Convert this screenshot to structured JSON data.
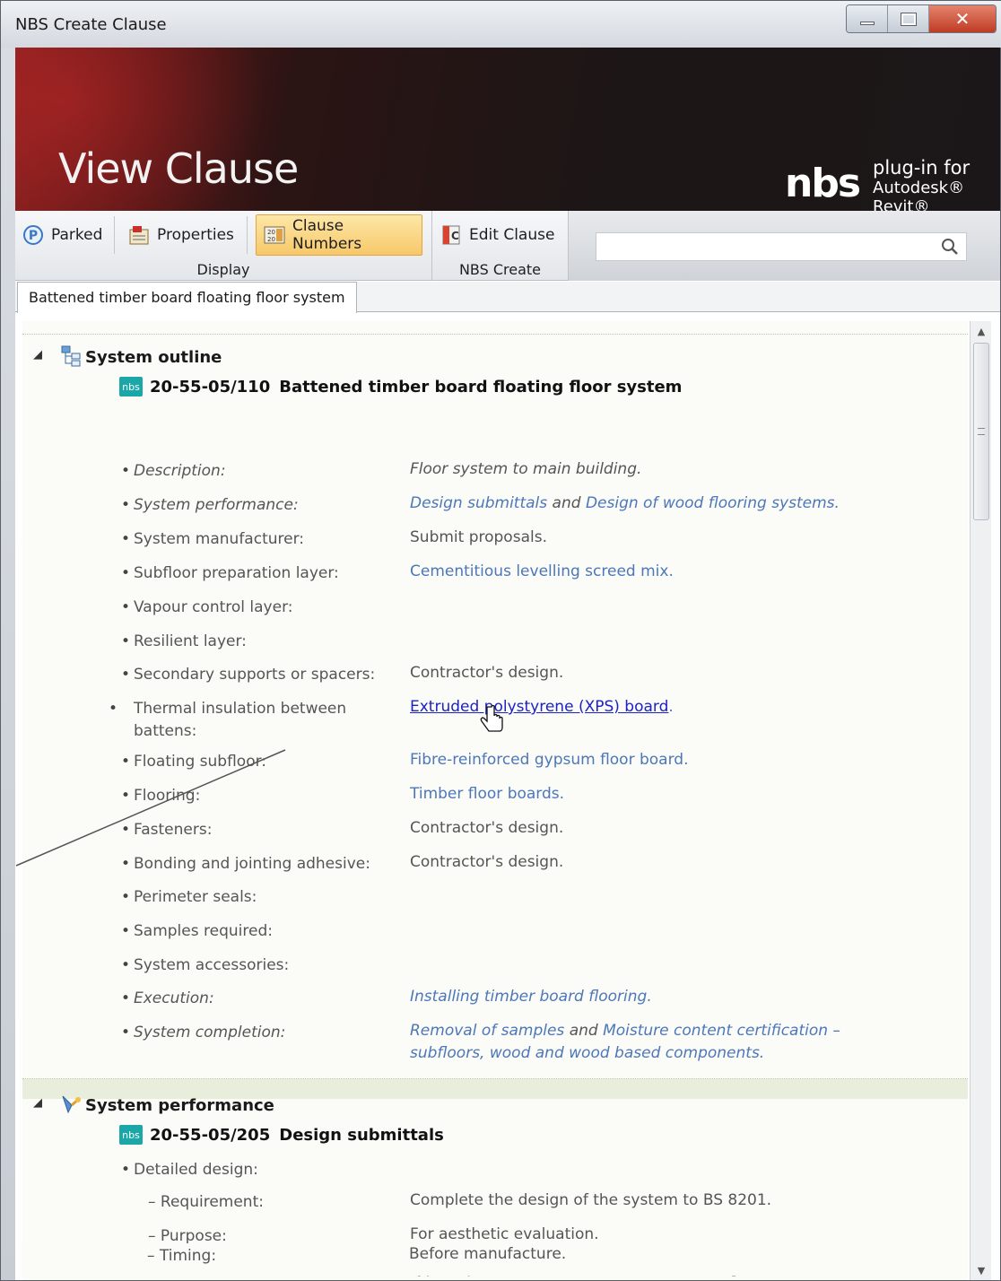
{
  "window": {
    "title": "NBS Create Clause",
    "controls": {
      "minimize": "minimize",
      "maximize": "maximize",
      "close": "close"
    }
  },
  "banner": {
    "title": "View Clause",
    "logo_text": "nbs",
    "logo_sub1": "plug-in for",
    "logo_sub2": "Autodesk® Revit®"
  },
  "toolbar": {
    "parked": "Parked",
    "properties": "Properties",
    "clause_numbers": "Clause Numbers",
    "edit_clause": "Edit Clause",
    "group_display": "Display",
    "group_nbs_create": "NBS Create",
    "search_placeholder": ""
  },
  "tab": {
    "label": "Battened timber board floating floor system"
  },
  "sections": {
    "outline": {
      "heading": "System outline",
      "badge": "nbs",
      "clause_number": "20-55-05/110",
      "clause_title": "Battened timber board floating floor system",
      "rows": [
        {
          "label": "Description:",
          "value": "Floor system to main building."
        },
        {
          "label": "System performance:",
          "link1": "Design submittals",
          "joiner": " and ",
          "link2": "Design of wood flooring systems",
          "end": "."
        },
        {
          "label": "System manufacturer:",
          "value": "Submit proposals."
        },
        {
          "label": "Subfloor preparation layer:",
          "link": "Cementitious levelling screed mix",
          "end": "."
        },
        {
          "label": "Vapour control layer:"
        },
        {
          "label": "Resilient layer:"
        },
        {
          "label": "Secondary supports or spacers:",
          "value": "Contractor's design."
        },
        {
          "label": "Thermal insulation between battens:",
          "link": "Extruded polystyrene (XPS) board",
          "end": "."
        },
        {
          "label": "Floating subfloor:",
          "link": "Fibre-reinforced gypsum floor board",
          "end": "."
        },
        {
          "label": "Flooring:",
          "link": "Timber floor boards",
          "end": "."
        },
        {
          "label": "Fasteners:",
          "value": "Contractor's design."
        },
        {
          "label": "Bonding and jointing adhesive:",
          "value": "Contractor's design."
        },
        {
          "label": "Perimeter seals:"
        },
        {
          "label": "Samples required:"
        },
        {
          "label": "System accessories:"
        },
        {
          "label": "Execution:",
          "link": "Installing timber board flooring",
          "end": "."
        },
        {
          "label": "System completion:",
          "link1": "Removal of samples",
          "joiner": " and ",
          "link2": "Moisture content certification –",
          "link3": "subfloors, wood and wood based components",
          "end": "."
        }
      ]
    },
    "performance": {
      "heading": "System performance",
      "badge": "nbs",
      "clause_number": "20-55-05/205",
      "clause_title": "Design submittals",
      "detail_label": "Detailed design:",
      "rows": [
        {
          "label": "Requirement:",
          "value": "Complete the design of the system to BS 8201."
        },
        {
          "label": "Purpose:",
          "value": "For aesthetic evaluation."
        },
        {
          "label": "Submittals:",
          "value": "Typical plan, elevation and section drawings at suitable scales."
        },
        {
          "label": "Timing:",
          "value": "Before manufacture."
        }
      ]
    }
  },
  "colors": {
    "link": "#4c77b8",
    "active_link": "#1c22c6",
    "nbs_badge": "#1ba7a7",
    "toolbar_active": "#f7c86a"
  },
  "icons": {
    "parked": "parked-p-icon",
    "properties": "properties-icon",
    "clause_numbers": "clause-numbers-icon",
    "edit_clause": "edit-clause-icon",
    "search": "search-icon",
    "outline": "tree-icon",
    "performance": "performance-icon",
    "cursor": "hand-cursor-icon"
  }
}
